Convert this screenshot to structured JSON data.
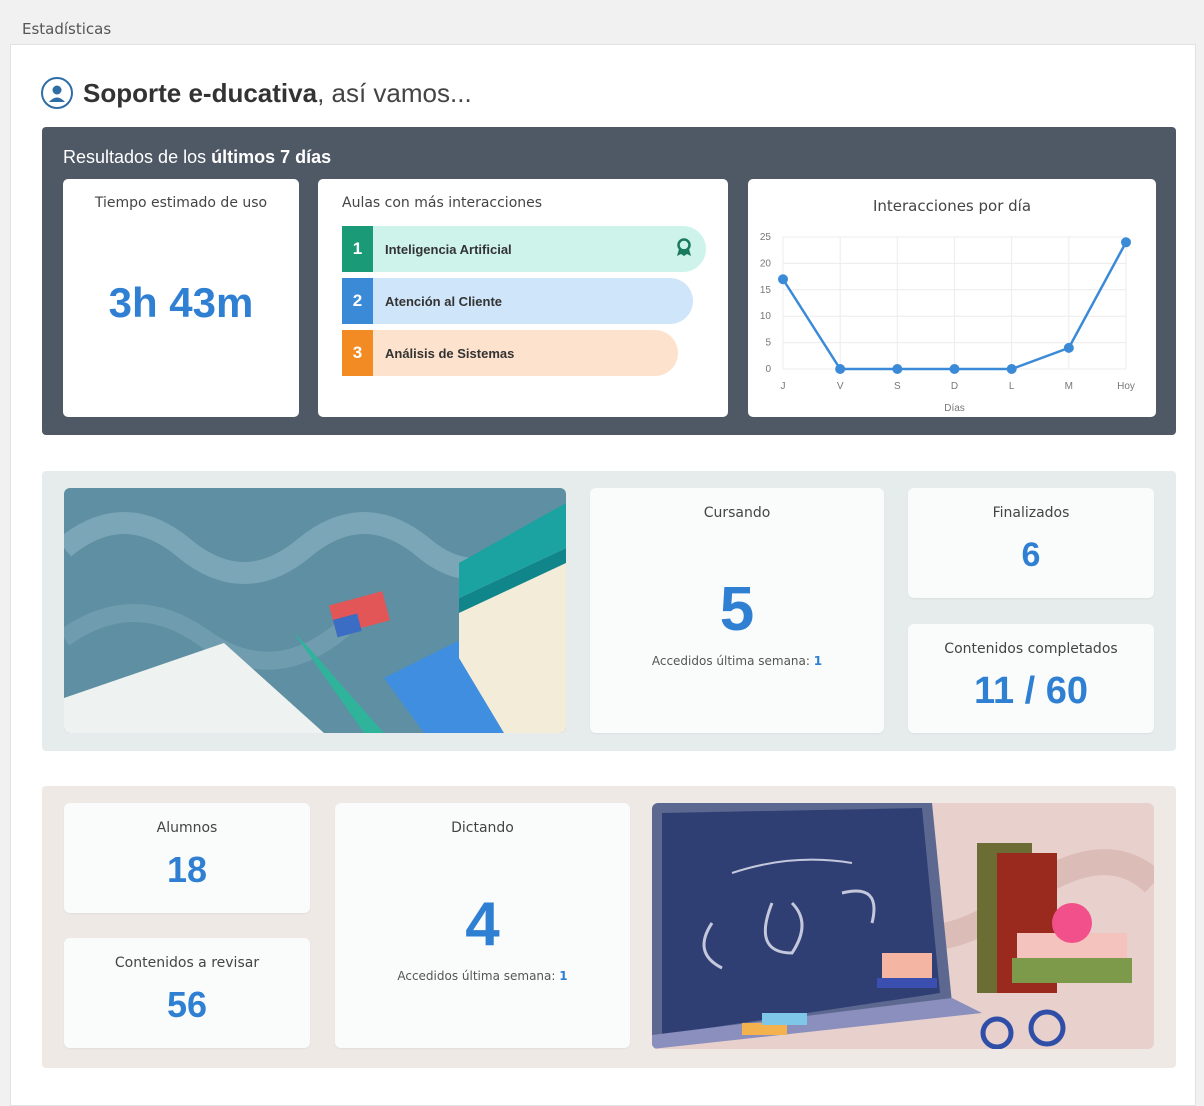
{
  "page": {
    "title": "Estadísticas"
  },
  "greeting": {
    "name": "Soporte e-ducativa",
    "suffix": ", así vamos..."
  },
  "weekly": {
    "title_prefix": "Resultados de los ",
    "title_bold": "últimos 7 días",
    "usage": {
      "label": "Tiempo estimado de uso",
      "value": "3h 43m"
    },
    "top_classes": {
      "label": "Aulas con más interacciones",
      "items": [
        {
          "rank": "1",
          "name": "Inteligencia Artificial",
          "color": "#1a9a76",
          "bg": "#cdf3ea"
        },
        {
          "rank": "2",
          "name": "Atención al Cliente",
          "color": "#3b8ad8",
          "bg": "#cfe5f9"
        },
        {
          "rank": "3",
          "name": "Análisis de Sistemas",
          "color": "#f28b23",
          "bg": "#fde3cd"
        }
      ]
    },
    "chart_title": "Interacciones por día"
  },
  "chart_data": {
    "type": "line",
    "title": "Interacciones por día",
    "xlabel": "Días",
    "ylabel": "",
    "categories": [
      "J",
      "V",
      "S",
      "D",
      "L",
      "M",
      "Hoy"
    ],
    "values": [
      17,
      0,
      0,
      0,
      0,
      4,
      24
    ],
    "ylim": [
      0,
      25
    ],
    "yticks": [
      "0",
      "5",
      "10",
      "15",
      "20",
      "25"
    ],
    "grid": true,
    "color": "#3b8ad8"
  },
  "student": {
    "cursando": {
      "label": "Cursando",
      "value": "5",
      "sub_label": "Accedidos última semana:",
      "sub_value": "1"
    },
    "finalizados": {
      "label": "Finalizados",
      "value": "6"
    },
    "contenidos": {
      "label": "Contenidos completados",
      "value": "11 / 60"
    }
  },
  "teacher": {
    "alumnos": {
      "label": "Alumnos",
      "value": "18"
    },
    "revisar": {
      "label": "Contenidos a revisar",
      "value": "56"
    },
    "dictando": {
      "label": "Dictando",
      "value": "4",
      "sub_label": "Accedidos última semana:",
      "sub_value": "1"
    }
  },
  "colors": {
    "accent": "#2f7fd3",
    "dark_panel": "#4f5865"
  },
  "icons": {
    "avatar": "support-avatar-icon",
    "award": "award-icon"
  }
}
